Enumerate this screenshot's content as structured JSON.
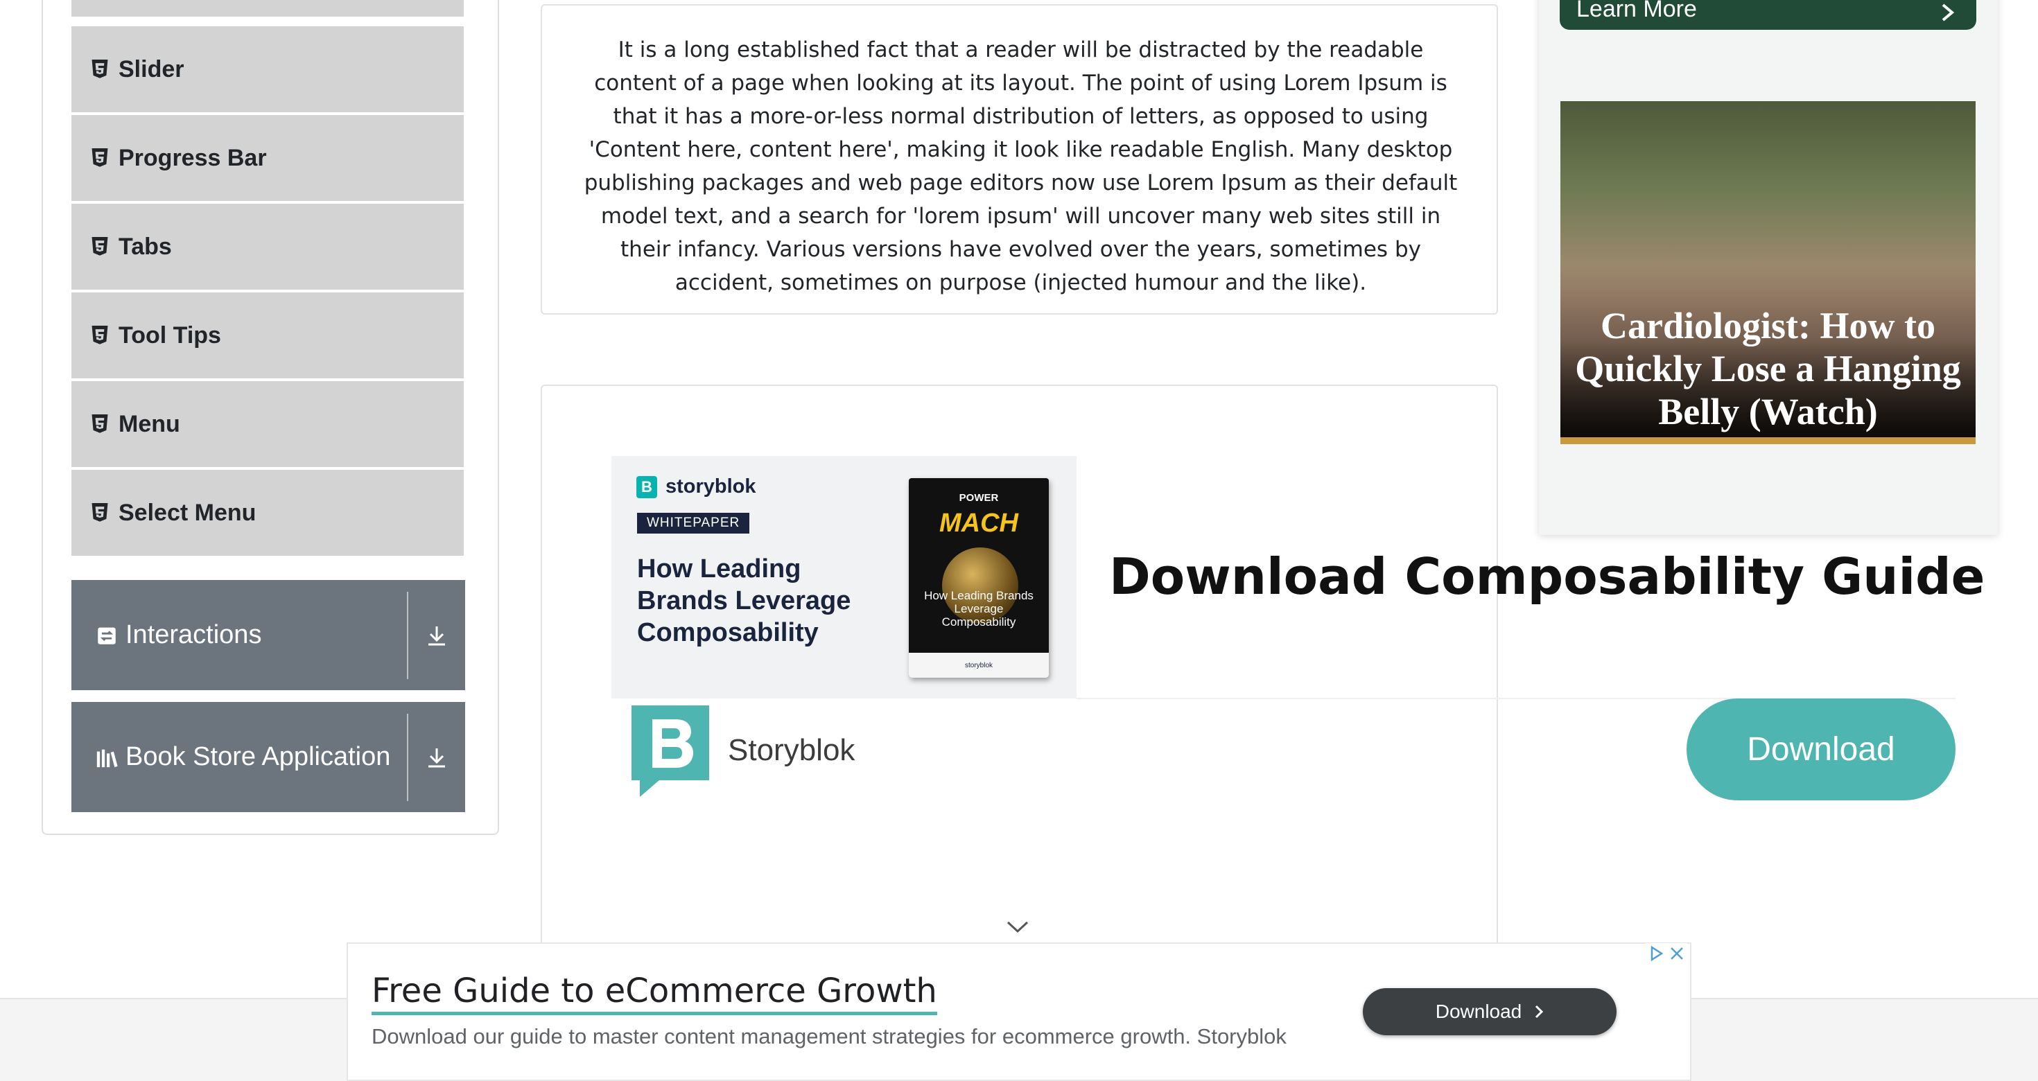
{
  "sidebar": {
    "items": [
      {
        "label": "Slider"
      },
      {
        "label": "Progress Bar"
      },
      {
        "label": "Tabs"
      },
      {
        "label": "Tool Tips"
      },
      {
        "label": "Menu"
      },
      {
        "label": "Select Menu"
      }
    ],
    "groups": [
      {
        "label": "Interactions"
      },
      {
        "label": "Book Store Application"
      }
    ]
  },
  "article": {
    "text": "It is a long established fact that a reader will be distracted by the readable content of a page when looking at its layout. The point of using Lorem Ipsum is that it has a more-or-less normal distribution of letters, as opposed to using 'Content here, content here', making it look like readable English. Many desktop publishing packages and web page editors now use Lorem Ipsum as their default model text, and a search for 'lorem ipsum' will uncover many web sites still in their infancy. Various versions have evolved over the years, sometimes by accident, sometimes on purpose (injected humour and the like)."
  },
  "storyblok_ad": {
    "logo_text": "storyblok",
    "badge": "WHITEPAPER",
    "headline": "How Leading Brands Leverage Composability",
    "book_top": "POWER",
    "book_brand": "MACH",
    "book_title": "How Leading Brands Leverage Composability",
    "book_footer": "storyblok",
    "title": "Download Composability Guide",
    "brand": "Storyblok",
    "button": "Download"
  },
  "side_ad": {
    "learn_more": "Learn More",
    "caption": "Cardiologist: How to Quickly Lose a Hanging Belly (Watch)"
  },
  "bottom_ad": {
    "title": "Free Guide to eCommerce Growth",
    "description": "Download our guide to master content management strategies for ecommerce growth. Storyblok",
    "button": "Download"
  },
  "colors": {
    "sidebar_item_bg": "#d3d3d3",
    "group_bg": "#6c757d",
    "accent_teal": "#4fb5b0",
    "learn_more_bg": "#214a37"
  }
}
